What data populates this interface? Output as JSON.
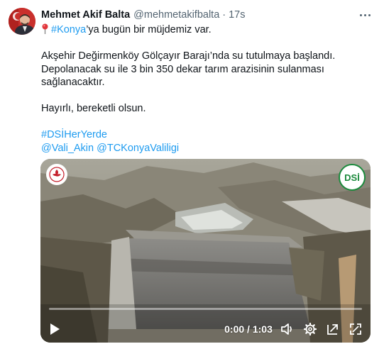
{
  "tweet": {
    "author_name": "Mehmet Akif Balta",
    "author_handle": "@mehmetakifbalta",
    "separator": "·",
    "time": "17s",
    "avatar_icon": "profile-photo",
    "more_icon": "more-horizontal-icon",
    "text": {
      "pin_icon": "round-pushpin-icon",
      "line1_hashtag": "#Konya",
      "line1_rest": "’ya bugün bir müjdemiz var.",
      "line2": " Akşehir Değirmenköy Gölçayır Barajı’nda su tutulmaya başlandı.",
      "line3": "Depolanacak su ile 3 bin 350 dekar tarım arazisinin sulanması",
      "line4": "sağlanacaktır.",
      "line5": "Hayırlı, bereketli olsun.",
      "hashtag": "#DSİHerYerde",
      "mention1": "@Vali_Akin",
      "mention2": "@TCKonyaValiligi"
    },
    "colors": {
      "link": "#1d9bf0",
      "text": "#0f1419",
      "muted": "#536471"
    }
  },
  "video": {
    "logo_left_icon": "konya-governorship-logo",
    "logo_right_text": "DSİ",
    "timecode": "0:00 / 1:03",
    "progress": 0,
    "play_icon": "play-icon",
    "volume_icon": "volume-icon",
    "settings_icon": "gear-icon",
    "popout_icon": "popout-icon",
    "fullscreen_icon": "fullscreen-icon"
  }
}
